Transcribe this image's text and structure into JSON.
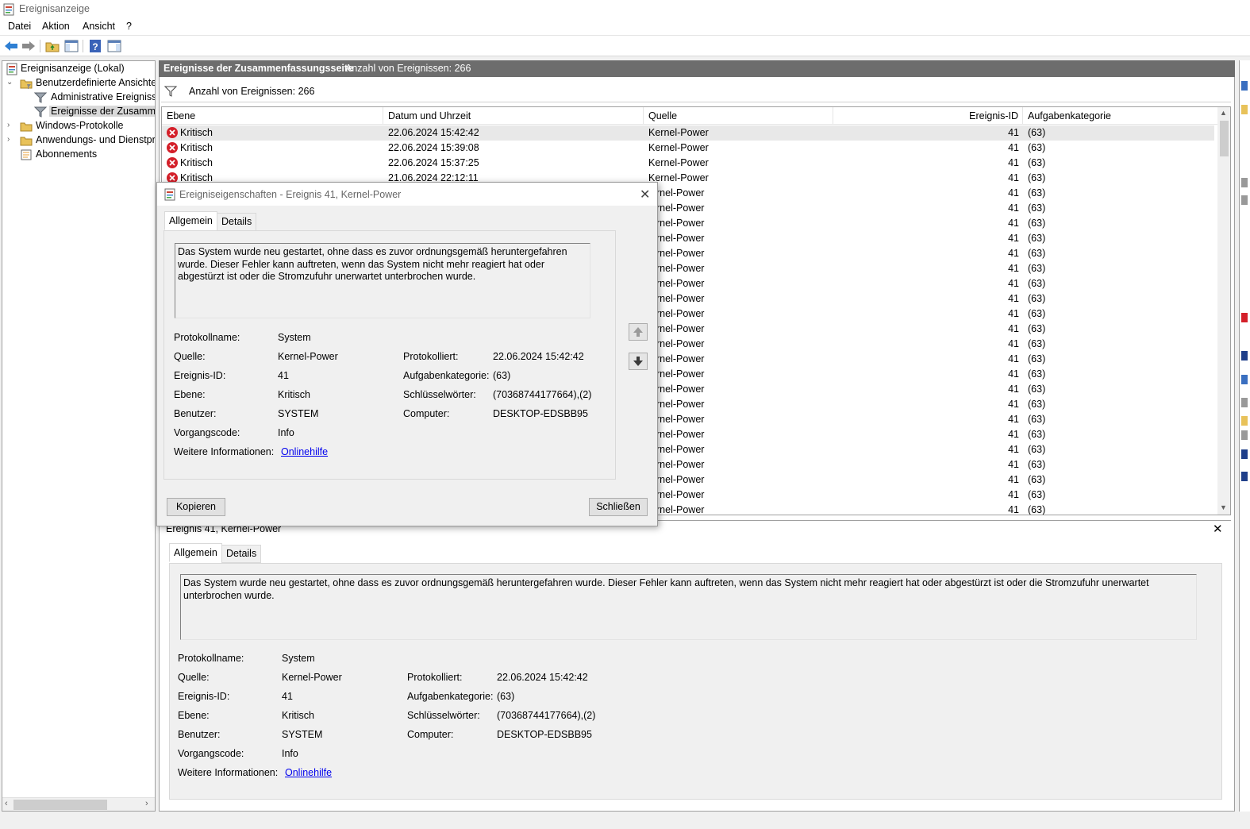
{
  "window": {
    "title": "Ereignisanzeige"
  },
  "menu": [
    "Datei",
    "Aktion",
    "Ansicht",
    "?"
  ],
  "tree": {
    "root": "Ereignisanzeige (Lokal)",
    "custom_views": "Benutzerdefinierte Ansichten",
    "admin_events": "Administrative Ereignisse",
    "summary_events": "Ereignisse der Zusammenfassungsseite",
    "windows_logs": "Windows-Protokolle",
    "app_logs": "Anwendungs- und Dienstprotokolle",
    "subscriptions": "Abonnements"
  },
  "center": {
    "header_title": "Ereignisse der Zusammenfassungsseite",
    "header_count": "Anzahl von Ereignissen: 266",
    "filter_text": "Anzahl von Ereignissen: 266"
  },
  "table": {
    "columns": [
      "Ebene",
      "Datum und Uhrzeit",
      "Quelle",
      "Ereignis-ID",
      "Aufgabenkategorie"
    ],
    "rows": [
      {
        "level": "Kritisch",
        "date": "22.06.2024 15:42:42",
        "source": "Kernel-Power",
        "id": "41",
        "cat": "(63)"
      },
      {
        "level": "Kritisch",
        "date": "22.06.2024 15:39:08",
        "source": "Kernel-Power",
        "id": "41",
        "cat": "(63)"
      },
      {
        "level": "Kritisch",
        "date": "22.06.2024 15:37:25",
        "source": "Kernel-Power",
        "id": "41",
        "cat": "(63)"
      },
      {
        "level": "Kritisch",
        "date": "21.06.2024 22:12:11",
        "source": "Kernel-Power",
        "id": "41",
        "cat": "(63)"
      }
    ],
    "hidden_rows": [
      {
        "source": "rnel-Power",
        "id": "41",
        "cat": "(63)"
      },
      {
        "source": "rnel-Power",
        "id": "41",
        "cat": "(63)"
      },
      {
        "source": "rnel-Power",
        "id": "41",
        "cat": "(63)"
      },
      {
        "source": "rnel-Power",
        "id": "41",
        "cat": "(63)"
      },
      {
        "source": "rnel-Power",
        "id": "41",
        "cat": "(63)"
      },
      {
        "source": "rnel-Power",
        "id": "41",
        "cat": "(63)"
      },
      {
        "source": "rnel-Power",
        "id": "41",
        "cat": "(63)"
      },
      {
        "source": "rnel-Power",
        "id": "41",
        "cat": "(63)"
      },
      {
        "source": "rnel-Power",
        "id": "41",
        "cat": "(63)"
      },
      {
        "source": "rnel-Power",
        "id": "41",
        "cat": "(63)"
      },
      {
        "source": "rnel-Power",
        "id": "41",
        "cat": "(63)"
      },
      {
        "source": "rnel-Power",
        "id": "41",
        "cat": "(63)"
      },
      {
        "source": "rnel-Power",
        "id": "41",
        "cat": "(63)"
      },
      {
        "source": "rnel-Power",
        "id": "41",
        "cat": "(63)"
      },
      {
        "source": "rnel-Power",
        "id": "41",
        "cat": "(63)"
      },
      {
        "source": "rnel-Power",
        "id": "41",
        "cat": "(63)"
      },
      {
        "source": "rnel-Power",
        "id": "41",
        "cat": "(63)"
      },
      {
        "source": "rnel-Power",
        "id": "41",
        "cat": "(63)"
      },
      {
        "source": "rnel-Power",
        "id": "41",
        "cat": "(63)"
      },
      {
        "source": "rnel-Power",
        "id": "41",
        "cat": "(63)"
      },
      {
        "source": "rnel-Power",
        "id": "41",
        "cat": "(63)"
      },
      {
        "source": "rnel-Power",
        "id": "41",
        "cat": "(63)"
      },
      {
        "source": "rnel-Power",
        "id": "41",
        "cat": "(63)"
      },
      {
        "source": "rnel-Power",
        "id": "41",
        "cat": "(63)"
      }
    ]
  },
  "preview": {
    "title": "Ereignis 41, Kernel-Power",
    "close": "✕",
    "tab_general": "Allgemein",
    "tab_details": "Details",
    "description": "Das System wurde neu gestartet, ohne dass es zuvor ordnungsgemäß heruntergefahren wurde. Dieser Fehler kann auftreten, wenn das System nicht mehr reagiert hat oder abgestürzt ist oder die Stromzufuhr unerwartet unterbrochen wurde."
  },
  "dialog": {
    "title": "Ereigniseigenschaften - Ereignis 41, Kernel-Power",
    "close": "✕",
    "tab_general": "Allgemein",
    "tab_details": "Details",
    "description": "Das System wurde neu gestartet, ohne dass es zuvor ordnungsgemäß heruntergefahren wurde. Dieser Fehler kann auftreten, wenn das System nicht mehr reagiert hat oder abgestürzt ist oder die Stromzufuhr unerwartet unterbrochen wurde.",
    "copy_button": "Kopieren",
    "close_button": "Schließen"
  },
  "fields": {
    "log_name_label": "Protokollname:",
    "log_name": "System",
    "source_label": "Quelle:",
    "source": "Kernel-Power",
    "logged_label": "Protokolliert:",
    "logged": "22.06.2024 15:42:42",
    "event_id_label": "Ereignis-ID:",
    "event_id": "41",
    "task_cat_label": "Aufgabenkategorie:",
    "task_cat": "(63)",
    "level_label": "Ebene:",
    "level": "Kritisch",
    "keywords_label": "Schlüsselwörter:",
    "keywords": "(70368744177664),(2)",
    "user_label": "Benutzer:",
    "user": "SYSTEM",
    "computer_label": "Computer:",
    "computer": "DESKTOP-EDSBB95",
    "opcode_label": "Vorgangscode:",
    "opcode": "Info",
    "more_info_label": "Weitere Informationen:",
    "more_info_link": "Onlinehilfe"
  },
  "colors": {
    "critical": "#d4202a",
    "header_bg": "#6d6d6d",
    "link": "#0000ee"
  }
}
